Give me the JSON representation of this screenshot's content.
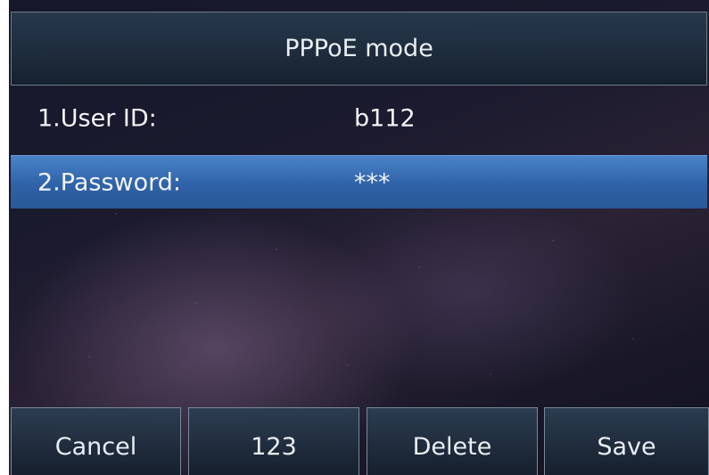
{
  "header": {
    "title": "PPPoE mode"
  },
  "fields": [
    {
      "label": "1.User ID:",
      "value": "b112"
    },
    {
      "label": "2.Password:",
      "value": "***"
    }
  ],
  "softkeys": [
    "Cancel",
    "123",
    "Delete",
    "Save"
  ],
  "colors": {
    "selected_row": "#2f62a8",
    "softkey_bg": "#1c2a3a",
    "text": "#f2f4f7"
  }
}
